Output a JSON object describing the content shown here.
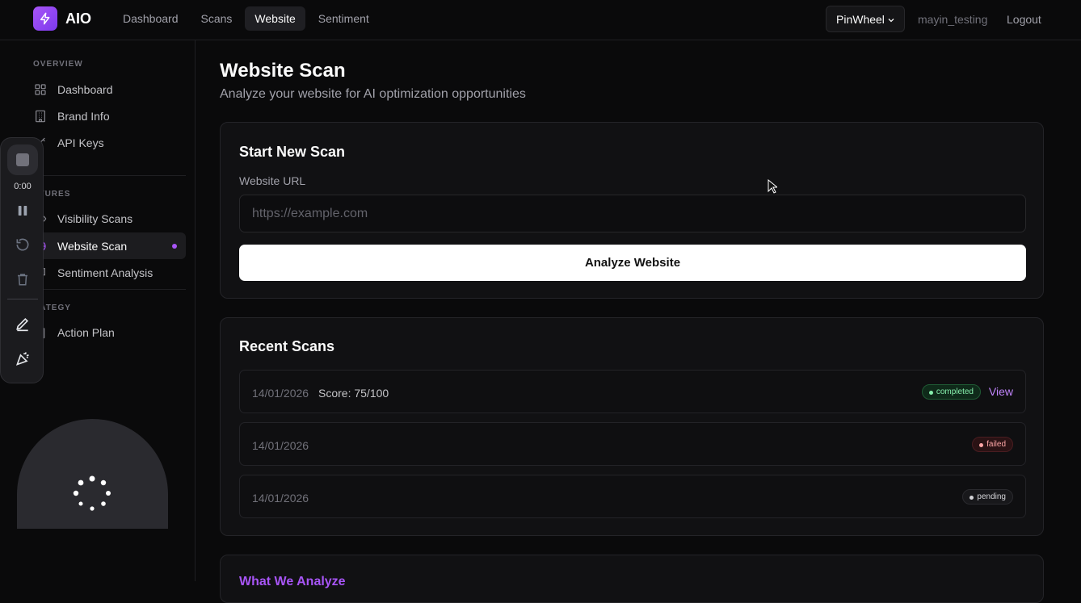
{
  "app": {
    "name": "AIO"
  },
  "nav": {
    "items": [
      "Dashboard",
      "Scans",
      "Website",
      "Sentiment"
    ],
    "active_index": 2
  },
  "header": {
    "brand_select": "PinWheel",
    "username": "mayin_testing",
    "logout": "Logout"
  },
  "sidebar": {
    "sections": [
      {
        "label": "OVERVIEW",
        "items": [
          "Dashboard",
          "Brand Info",
          "API Keys"
        ]
      },
      {
        "label": "ATURES",
        "items": [
          "Visibility Scans",
          "Website Scan",
          "Sentiment Analysis"
        ]
      },
      {
        "label": "RATEGY",
        "items": [
          "Action Plan"
        ]
      }
    ],
    "active_item": "Website Scan"
  },
  "recorder": {
    "time": "0:00"
  },
  "page": {
    "title": "Website Scan",
    "subtitle": "Analyze your website for AI optimization opportunities"
  },
  "new_scan": {
    "title": "Start New Scan",
    "url_label": "Website URL",
    "url_placeholder": "https://example.com",
    "url_value": "",
    "button": "Analyze Website"
  },
  "recent_scans": {
    "title": "Recent Scans",
    "rows": [
      {
        "date": "14/01/2026",
        "score": "Score: 75/100",
        "status": "completed",
        "action": "View"
      },
      {
        "date": "14/01/2026",
        "score": "",
        "status": "failed",
        "action": ""
      },
      {
        "date": "14/01/2026",
        "score": "",
        "status": "pending",
        "action": ""
      }
    ]
  },
  "what_we_analyze": {
    "title": "What We Analyze"
  },
  "colors": {
    "accent": "#a855f7",
    "background": "#0a0a0b",
    "card": "#111113"
  }
}
